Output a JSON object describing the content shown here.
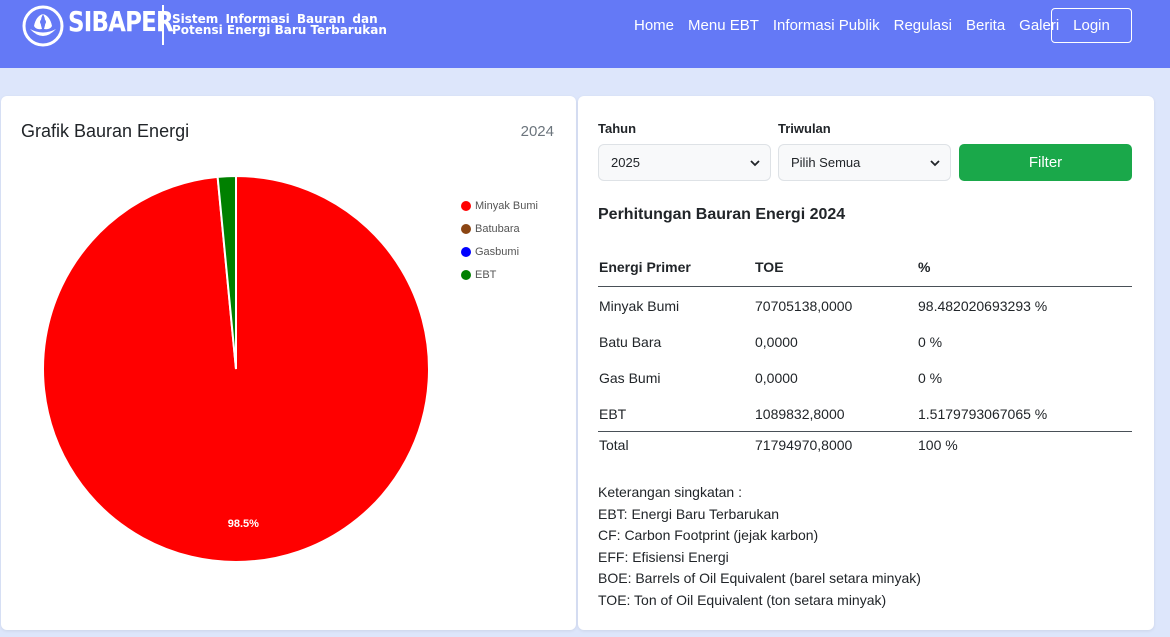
{
  "brand": {
    "name": "SIBAPER",
    "tagline_line1": "Sistem Informasi Bauran dan",
    "tagline_line2": "Potensi Energi Baru Terbarukan"
  },
  "nav": {
    "items": [
      "Home",
      "Menu EBT",
      "Informasi Publik",
      "Regulasi",
      "Berita",
      "Galeri"
    ],
    "login_label": "Login"
  },
  "chart_panel": {
    "title": "Grafik Bauran Energi",
    "year": "2024"
  },
  "chart_data": {
    "type": "pie",
    "title": "Grafik Bauran Energi",
    "categories": [
      "Minyak Bumi",
      "Batubara",
      "Gasbumi",
      "EBT"
    ],
    "values": [
      98.482020693293,
      0,
      0,
      1.5179793067065
    ],
    "colors": [
      "#ff0000",
      "#8b4513",
      "#0000ff",
      "#008000"
    ],
    "slice_labels": [
      "98.5%",
      "",
      "",
      ""
    ],
    "legend_position": "top-right"
  },
  "filter": {
    "year_label": "Tahun",
    "year_value": "2025",
    "quarter_label": "Triwulan",
    "quarter_value": "Pilih Semua",
    "button_label": "Filter"
  },
  "calculation": {
    "title": "Perhitungan Bauran Energi 2024",
    "headers": [
      "Energi Primer",
      "TOE",
      "%"
    ],
    "rows": [
      [
        "Minyak Bumi",
        "70705138,0000",
        "98.482020693293 %"
      ],
      [
        "Batu Bara",
        "0,0000",
        "0 %"
      ],
      [
        "Gas Bumi",
        "0,0000",
        "0 %"
      ],
      [
        "EBT",
        "1089832,8000",
        "1.5179793067065 %"
      ]
    ],
    "total": [
      "Total",
      "71794970,8000",
      "100 %"
    ]
  },
  "notes": {
    "heading": "Keterangan singkatan :",
    "lines": [
      "EBT: Energi Baru Terbarukan",
      "CF: Carbon Footprint (jejak karbon)",
      "EFF: Efisiensi Energi",
      "BOE: Barrels of Oil Equivalent (barel setara minyak)",
      "TOE: Ton of Oil Equivalent (ton setara minyak)"
    ]
  }
}
